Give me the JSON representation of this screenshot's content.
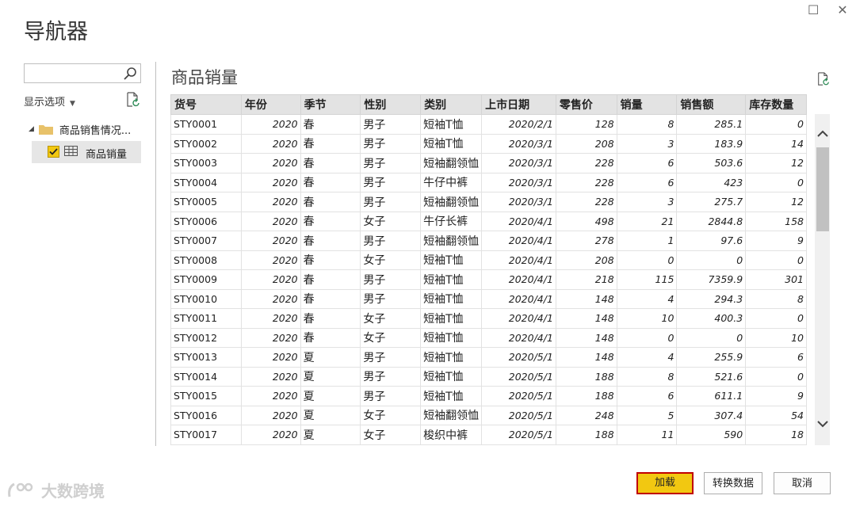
{
  "window": {
    "title": "导航器",
    "restore_icon": "☐",
    "close_icon": "✕"
  },
  "left": {
    "search_placeholder": "",
    "display_options": "显示选项",
    "tree_parent": "商品销售情况...",
    "tree_child": "商品销量"
  },
  "preview": {
    "title": "商品销量",
    "columns": [
      "货号",
      "年份",
      "季节",
      "性别",
      "类别",
      "上市日期",
      "零售价",
      "销量",
      "销售额",
      "库存数量"
    ],
    "rows": [
      [
        "STY0001",
        "2020",
        "春",
        "男子",
        "短袖T恤",
        "2020/2/1",
        "128",
        "8",
        "285.1",
        "0"
      ],
      [
        "STY0002",
        "2020",
        "春",
        "男子",
        "短袖T恤",
        "2020/3/1",
        "208",
        "3",
        "183.9",
        "14"
      ],
      [
        "STY0003",
        "2020",
        "春",
        "男子",
        "短袖翻领恤",
        "2020/3/1",
        "228",
        "6",
        "503.6",
        "12"
      ],
      [
        "STY0004",
        "2020",
        "春",
        "男子",
        "牛仔中裤",
        "2020/3/1",
        "228",
        "6",
        "423",
        "0"
      ],
      [
        "STY0005",
        "2020",
        "春",
        "男子",
        "短袖翻领恤",
        "2020/3/1",
        "228",
        "3",
        "275.7",
        "12"
      ],
      [
        "STY0006",
        "2020",
        "春",
        "女子",
        "牛仔长裤",
        "2020/4/1",
        "498",
        "21",
        "2844.8",
        "158"
      ],
      [
        "STY0007",
        "2020",
        "春",
        "男子",
        "短袖翻领恤",
        "2020/4/1",
        "278",
        "1",
        "97.6",
        "9"
      ],
      [
        "STY0008",
        "2020",
        "春",
        "女子",
        "短袖T恤",
        "2020/4/1",
        "208",
        "0",
        "0",
        "0"
      ],
      [
        "STY0009",
        "2020",
        "春",
        "男子",
        "短袖T恤",
        "2020/4/1",
        "218",
        "115",
        "7359.9",
        "301"
      ],
      [
        "STY0010",
        "2020",
        "春",
        "男子",
        "短袖T恤",
        "2020/4/1",
        "148",
        "4",
        "294.3",
        "8"
      ],
      [
        "STY0011",
        "2020",
        "春",
        "女子",
        "短袖T恤",
        "2020/4/1",
        "148",
        "10",
        "400.3",
        "0"
      ],
      [
        "STY0012",
        "2020",
        "春",
        "女子",
        "短袖T恤",
        "2020/4/1",
        "148",
        "0",
        "0",
        "10"
      ],
      [
        "STY0013",
        "2020",
        "夏",
        "男子",
        "短袖T恤",
        "2020/5/1",
        "148",
        "4",
        "255.9",
        "6"
      ],
      [
        "STY0014",
        "2020",
        "夏",
        "男子",
        "短袖T恤",
        "2020/5/1",
        "188",
        "8",
        "521.6",
        "0"
      ],
      [
        "STY0015",
        "2020",
        "夏",
        "男子",
        "短袖T恤",
        "2020/5/1",
        "188",
        "6",
        "611.1",
        "9"
      ],
      [
        "STY0016",
        "2020",
        "夏",
        "女子",
        "短袖翻领恤",
        "2020/5/1",
        "248",
        "5",
        "307.4",
        "54"
      ],
      [
        "STY0017",
        "2020",
        "夏",
        "女子",
        "梭织中裤",
        "2020/5/1",
        "188",
        "11",
        "590",
        "18"
      ]
    ]
  },
  "buttons": {
    "load": "加载",
    "transform": "转换数据",
    "cancel": "取消"
  },
  "watermark": "大数跨境",
  "colors": {
    "load_bg": "#f2c811",
    "load_border": "#c00000",
    "checkbox": "#f2c811"
  }
}
